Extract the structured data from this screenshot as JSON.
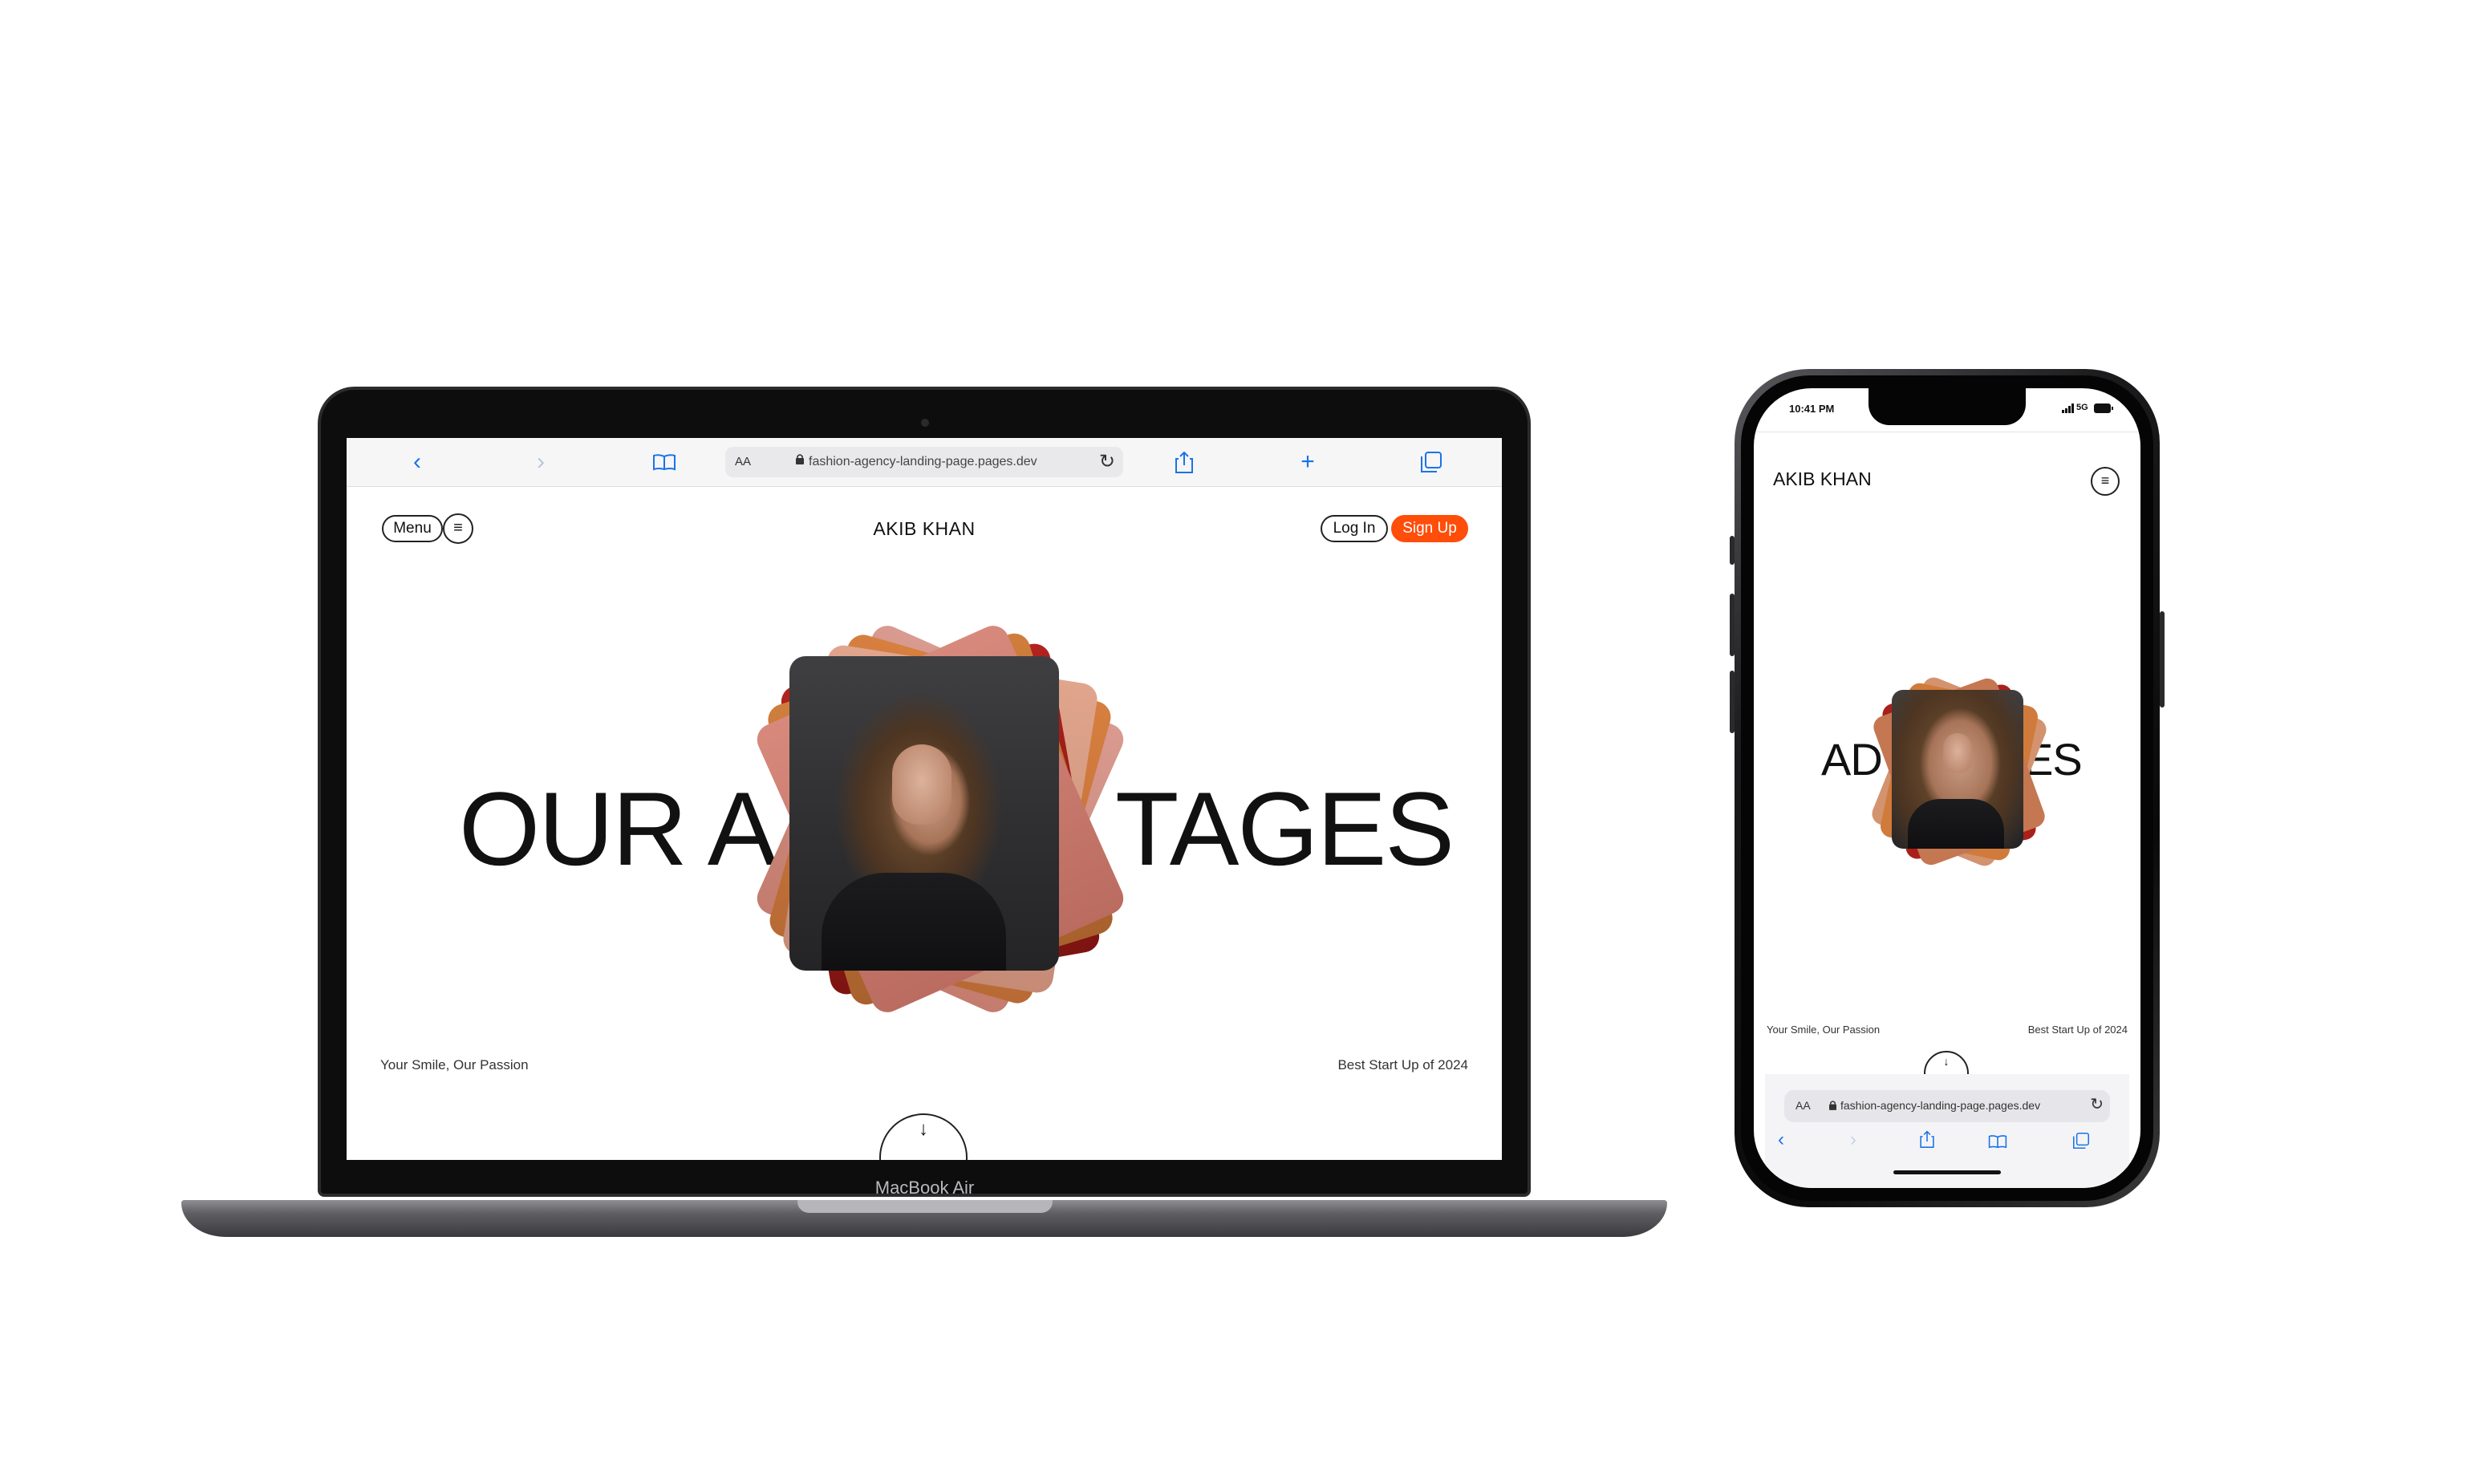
{
  "browser": {
    "url": "fashion-agency-landing-page.pages.dev",
    "reader_label": "AA",
    "icons": {
      "back": "chevron-left-icon",
      "forward": "chevron-right-icon",
      "bookmarks": "book-icon",
      "lock": "lock-icon",
      "reload": "reload-icon",
      "share": "share-icon",
      "new_tab": "plus-icon",
      "tabs": "tabs-icon"
    },
    "accent_color": "#1a73e8"
  },
  "site": {
    "menu_label": "Menu",
    "brand": "AKIB KHAN",
    "login_label": "Log In",
    "signup_label": "Sign Up",
    "signup_color": "#ff4d0a",
    "hero_left": "OUR A",
    "hero_right": "TAGES",
    "tagline_left": "Your Smile, Our Passion",
    "tagline_right": "Best Start Up of 2024"
  },
  "laptop": {
    "model_label": "MacBook Air"
  },
  "phone": {
    "time": "10:41 PM",
    "network": "5G",
    "brand": "AKIB KHAN",
    "hero_left": "AD",
    "hero_right": "ES",
    "tagline_left": "Your Smile, Our Passion",
    "tagline_right": "Best Start Up of 2024",
    "url": "fashion-agency-landing-page.pages.dev",
    "reader_label": "AA"
  }
}
